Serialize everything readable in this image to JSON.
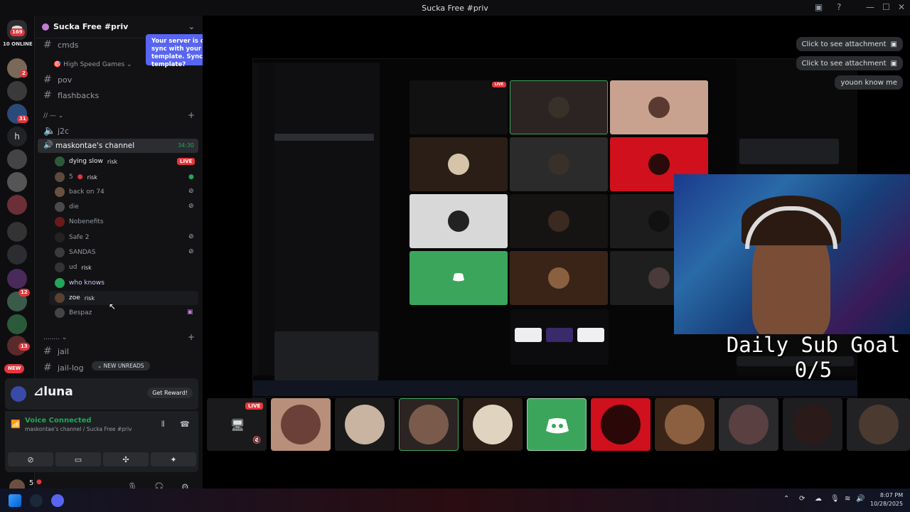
{
  "window": {
    "title": "Sucka Free #priv"
  },
  "rail": {
    "home_badge": "169",
    "online_label": "10 ONLINE",
    "new_label": "NEW",
    "badges": [
      "2",
      "31",
      "12",
      "13"
    ]
  },
  "server": {
    "name": "Sucka Free #priv"
  },
  "channels": {
    "cmds": "cmds",
    "cat_high_speed": "High Speed Games",
    "pov": "pov",
    "flashbacks": "flashbacks",
    "cat_misc": "// —",
    "j2c": "j2c",
    "voice_channel": "maskontae's channel",
    "voice_timer": "34:30",
    "jail": "jail",
    "jail_log": "jail-log",
    "new_unreads": "NEW UNREADS"
  },
  "voice_users": [
    {
      "name": "dying slow",
      "tag": "risk",
      "live": "LIVE"
    },
    {
      "name": "5",
      "tag": "risk"
    },
    {
      "name": "back on 74"
    },
    {
      "name": "die"
    },
    {
      "name": "Nobenefits"
    },
    {
      "name": "Safe 2"
    },
    {
      "name": "SANDAS"
    },
    {
      "name": "ud",
      "tag": "risk"
    },
    {
      "name": "who knows"
    },
    {
      "name": "zoe",
      "tag": "risk"
    },
    {
      "name": "Bespaz"
    }
  ],
  "toast": {
    "text": "Your server is out of sync with your server template. Sync template?"
  },
  "promo": {
    "brand": "luna",
    "button": "Get Reward!"
  },
  "voice_panel": {
    "status": "Voice Connected",
    "location": "maskontae's channel / Sucka Free #priv"
  },
  "user": {
    "name": "5",
    "count": "55"
  },
  "chat": {
    "pill1": "Click to see attachment",
    "pill2": "Click to see attachment",
    "pill3": "youon know me"
  },
  "stream": {
    "live_label": "LIVE",
    "goal_title": "Daily Sub Goal",
    "goal_count": "0/5"
  },
  "taskbar": {
    "time": "8:07 PM",
    "date": "10/28/2025"
  },
  "colors": {
    "accent": "#5865f2",
    "live_red": "#e3363d",
    "voice_green": "#23a55a",
    "discord_green_tile": "#3ba55c"
  }
}
